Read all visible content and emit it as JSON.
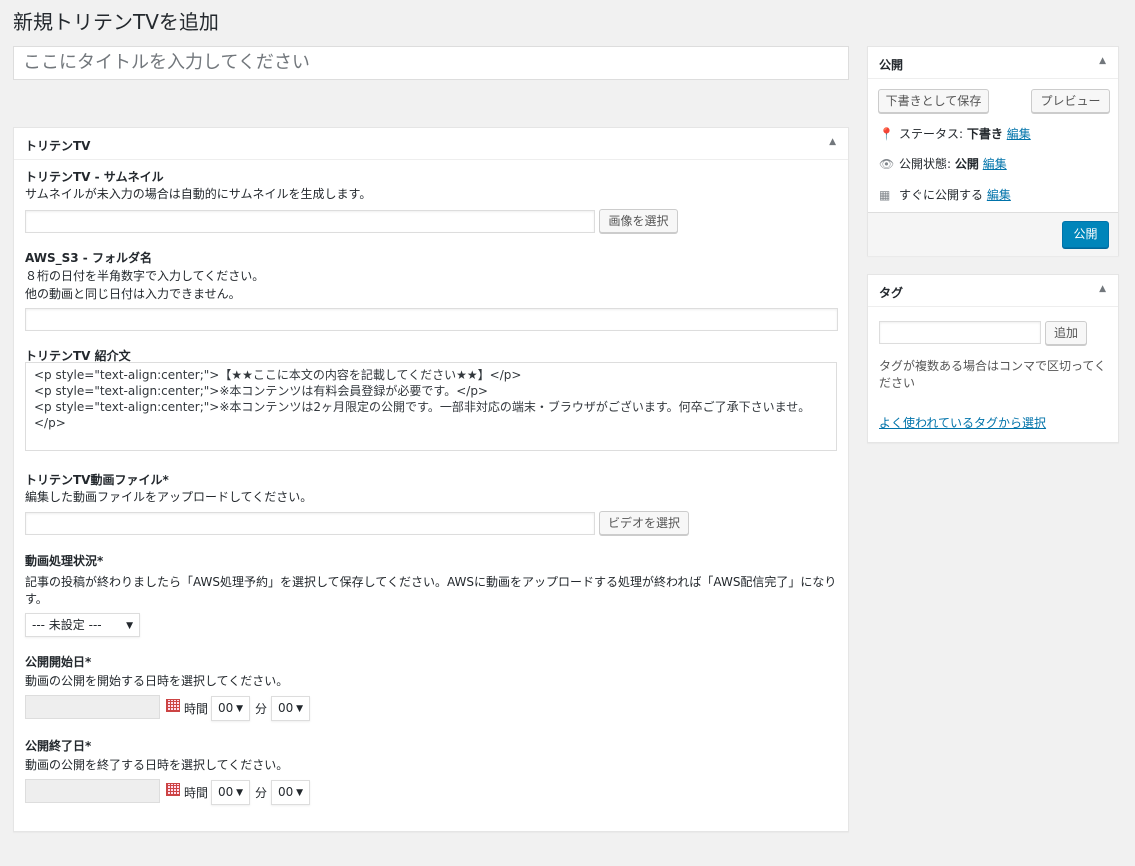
{
  "page_title": "新規トリテンTVを追加",
  "title_placeholder": "ここにタイトルを入力してください",
  "main_box": {
    "title": "トリテンTV",
    "thumbnail": {
      "label": "トリテンTV - サムネイル",
      "desc": "サムネイルが未入力の場合は自動的にサムネイルを生成します。",
      "button": "画像を選択"
    },
    "folder": {
      "label": "AWS_S3 - フォルダ名",
      "desc1": "８桁の日付を半角数字で入力してください。",
      "desc2": "他の動画と同じ日付は入力できません。"
    },
    "intro": {
      "label": "トリテンTV 紹介文",
      "lines": [
        "<p style=\"text-align:center;\">【★★ここに本文の内容を記載してください★★】</p>",
        "",
        "<p style=\"text-align:center;\">※本コンテンツは有料会員登録が必要です。</p>",
        "<p style=\"text-align:center;\">※本コンテンツは2ヶ月限定の公開です。一部非対応の端末・ブラウザがございます。何卒ご了承下さいませ。",
        "</p>"
      ]
    },
    "video": {
      "label": "トリテンTV動画ファイル*",
      "desc": "編集した動画ファイルをアップロードしてください。",
      "button": "ビデオを選択"
    },
    "status": {
      "label": "動画処理状況*",
      "desc1": "記事の投稿が終わりましたら「AWS処理予約」を選択して保存してください。AWSに動画をアップロードする処理が終われば「AWS配信完了」になりま",
      "desc2": "す。",
      "select": "--- 未設定 ---"
    },
    "start": {
      "label": "公開開始日*",
      "desc": "動画の公開を開始する日時を選択してください。",
      "hour_label": "時間",
      "hour": "00",
      "min_label": "分",
      "min": "00"
    },
    "end": {
      "label": "公開終了日*",
      "desc": "動画の公開を終了する日時を選択してください。",
      "hour_label": "時間",
      "hour": "00",
      "min_label": "分",
      "min": "00"
    }
  },
  "publish_box": {
    "title": "公開",
    "save_draft": "下書きとして保存",
    "preview": "プレビュー",
    "status_label": "ステータス:",
    "status_value": "下書き",
    "visibility_label": "公開状態:",
    "visibility_value": "公開",
    "schedule_label": "すぐに公開する",
    "edit": "編集",
    "publish_button": "公開"
  },
  "tag_box": {
    "title": "タグ",
    "add_button": "追加",
    "hint1": "タグが複数ある場合はコンマで区切ってく",
    "hint2": "ださい",
    "popular_link": "よく使われているタグから選択"
  }
}
